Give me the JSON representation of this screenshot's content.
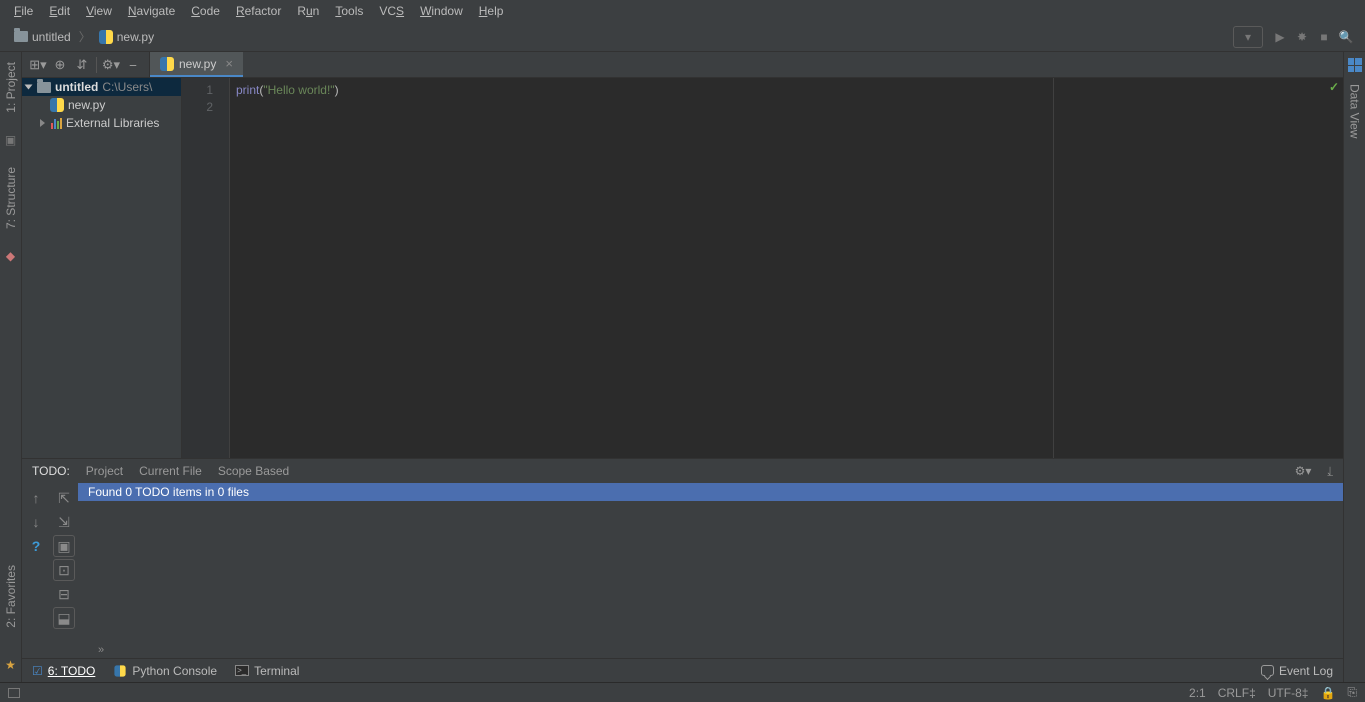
{
  "menu": {
    "items": [
      "File",
      "Edit",
      "View",
      "Navigate",
      "Code",
      "Refactor",
      "Run",
      "Tools",
      "VCS",
      "Window",
      "Help"
    ]
  },
  "breadcrumb": {
    "project": "untitled",
    "file": "new.py"
  },
  "toolbar_right": {
    "combo_glyph": "▾",
    "run_glyph": "▶",
    "debug_glyph": "✸",
    "stop_glyph": "■",
    "search_glyph": "🔍"
  },
  "left_stripe": {
    "project": "1: Project",
    "structure": "7: Structure",
    "favorites": "2: Favorites"
  },
  "right_stripe": {
    "dataview": "Data View"
  },
  "project_tree": {
    "root_name": "untitled",
    "root_path": "C:\\Users\\",
    "file": "new.py",
    "ext_lib": "External Libraries"
  },
  "editor": {
    "tab": "new.py",
    "line_numbers": [
      "1",
      "2"
    ],
    "code": {
      "builtin": "print",
      "paren_open": "(",
      "string": "\"Hello world!\"",
      "paren_close": ")"
    }
  },
  "todo": {
    "label": "TODO:",
    "tabs": [
      "Project",
      "Current File",
      "Scope Based"
    ],
    "message": "Found 0 TODO items in 0 files",
    "more": "»"
  },
  "bottom": {
    "todo": "6: TODO",
    "pyconsole": "Python Console",
    "terminal": "Terminal",
    "eventlog": "Event Log"
  },
  "status": {
    "pos": "2:1",
    "linesep": "CRLF",
    "enc": "UTF-8",
    "lock": "🔒",
    "ctx": "⎘"
  }
}
